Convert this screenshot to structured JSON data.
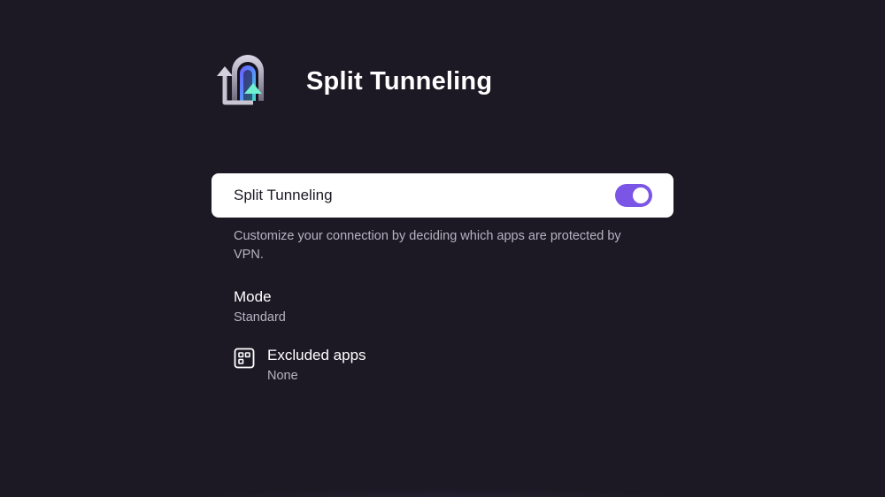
{
  "header": {
    "title": "Split Tunneling",
    "icon": "split-tunnel-icon"
  },
  "toggle": {
    "label": "Split Tunneling",
    "enabled": true,
    "accent_color": "#7b55e6"
  },
  "description": "Customize your connection by deciding which apps are protected by VPN.",
  "settings": {
    "mode": {
      "title": "Mode",
      "value": "Standard"
    },
    "excluded_apps": {
      "title": "Excluded apps",
      "value": "None",
      "icon": "apps-grid-icon"
    }
  },
  "colors": {
    "background": "#1c1925",
    "card": "#ffffff",
    "secondary_text": "#b7b3c2"
  }
}
